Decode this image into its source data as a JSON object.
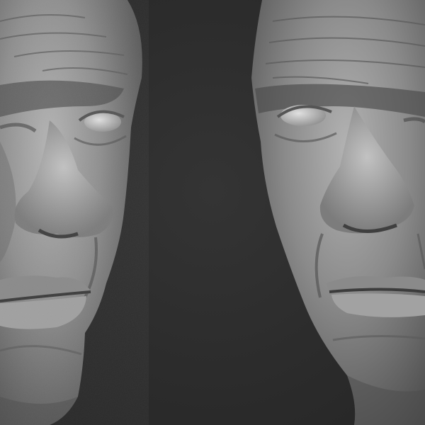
{
  "scene": {
    "background_color": "#2c2c2c",
    "clay_color": "#8f8f8f",
    "subjects": [
      {
        "name": "sculpted-head-left",
        "facing": "right"
      },
      {
        "name": "sculpted-head-right",
        "facing": "left"
      }
    ]
  }
}
